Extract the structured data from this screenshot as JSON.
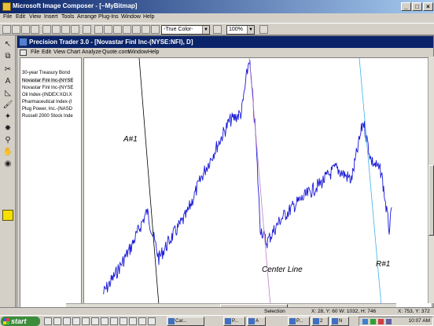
{
  "outer_window": {
    "title": "Microsoft Image Composer - [~MyBitmap]"
  },
  "outer_menu": [
    "File",
    "Edit",
    "View",
    "Insert",
    "Tools",
    "Arrange",
    "Plug-Ins",
    "Window",
    "Help"
  ],
  "toolbar": {
    "color_mode": "-True Color-",
    "zoom": "100%"
  },
  "inner_window": {
    "title": "Precision Trader 3.0 - [Novastar Finl Inc-(NYSE:NFI), D]"
  },
  "inner_menu": [
    "File",
    "Edit",
    "View",
    "Chart",
    "Analyze",
    "Quote.com",
    "Window",
    "Help"
  ],
  "security_list": [
    "30-year Treasury Bond",
    "Novastar Finl Inc-(NYSE",
    "Novastar Finl Inc-(NYSE",
    "Oil Index-(INDEX:XOI.X",
    "Pharmaceutical Index-(I",
    "Plug Power, Inc.-(NASD",
    "Russell 2000 Stock Inde"
  ],
  "chart_annotations": {
    "line_a": "A#1",
    "center": "Center Line",
    "line_r": "R#1"
  },
  "status_bar": {
    "selection": "Selection",
    "info": "X: 28, Y: 60  W: 1032, H: 746",
    "coords": "X: 753, Y: 372"
  },
  "taskbar": {
    "start": "start",
    "tasks": [
      "Car...",
      "P...",
      "A",
      "P...",
      "2",
      "N"
    ],
    "clock": "10:07 AM"
  },
  "colors": {
    "outer_title": "#0a246a",
    "price_line": "#1a1ad8",
    "line_a": "#000000",
    "center_line": "#c080c0",
    "line_r": "#40b0e8"
  }
}
